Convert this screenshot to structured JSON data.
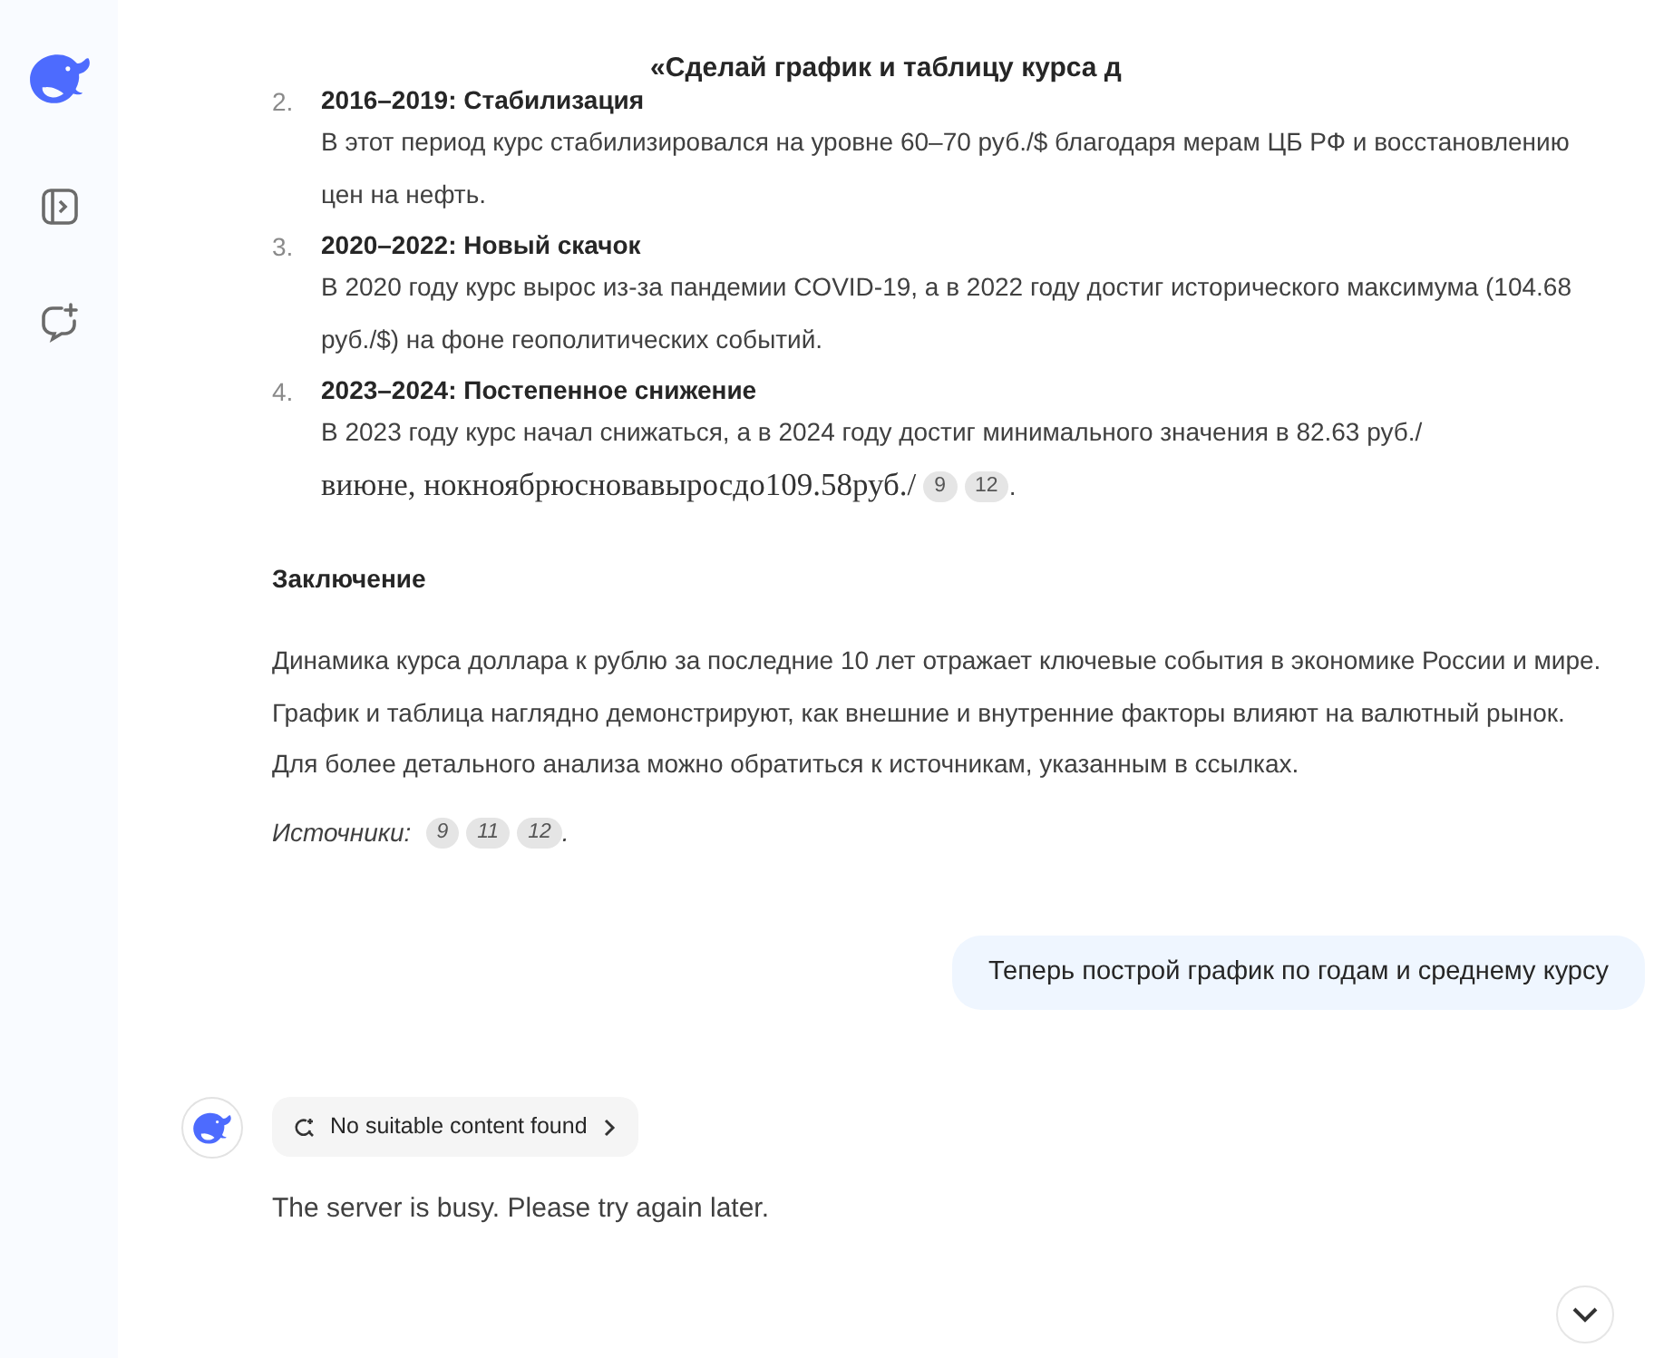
{
  "header": {
    "title": "«Сделай график и таблицу курса д"
  },
  "answer": {
    "items": [
      {
        "number": "2.",
        "title": "2016–2019: Стабилизация",
        "lines": [
          {
            "text": "В этот период курс стабилизировался на уровне 60–70 руб./$ благодаря мерам ЦБ РФ и восстановлению цен на нефть."
          }
        ]
      },
      {
        "number": "3.",
        "title": "2020–2022: Новый скачок",
        "lines": [
          {
            "text": "В 2020 году курс вырос из-за пандемии COVID-19, а в 2022 году достиг исторического максимума (104.68 руб./$) на фоне геополитических событий."
          }
        ]
      },
      {
        "number": "4.",
        "title": "2023–2024: Постепенное снижение",
        "lines": [
          {
            "text": "В 2023 году курс начал снижаться, а в 2024 году достиг минимального значения в 82.63 руб./",
            "kind": "normal"
          },
          {
            "text": "виюне, нокноябрюсновавыросдо109.58руб./",
            "kind": "serif"
          }
        ],
        "citations": [
          "9",
          "12"
        ],
        "end": "."
      }
    ],
    "conclusion_title": "Заключение",
    "conclusion": "Динамика курса доллара к рублю за последние 10 лет отражает ключевые события в экономике России и мире. График и таблица наглядно демонстрируют, как внешние и внутренние факторы влияют на валютный рынок. Для более детального анализа можно обратиться к источникам, указанным в ссылках.",
    "sources_label": "Источники:",
    "sources": [
      "9",
      "11",
      "12"
    ],
    "sources_end": "."
  },
  "user_message": "Теперь построй график по годам и среднему курсу",
  "reply": {
    "search_chip": "No suitable content found",
    "text": "The server is busy. Please try again later."
  }
}
